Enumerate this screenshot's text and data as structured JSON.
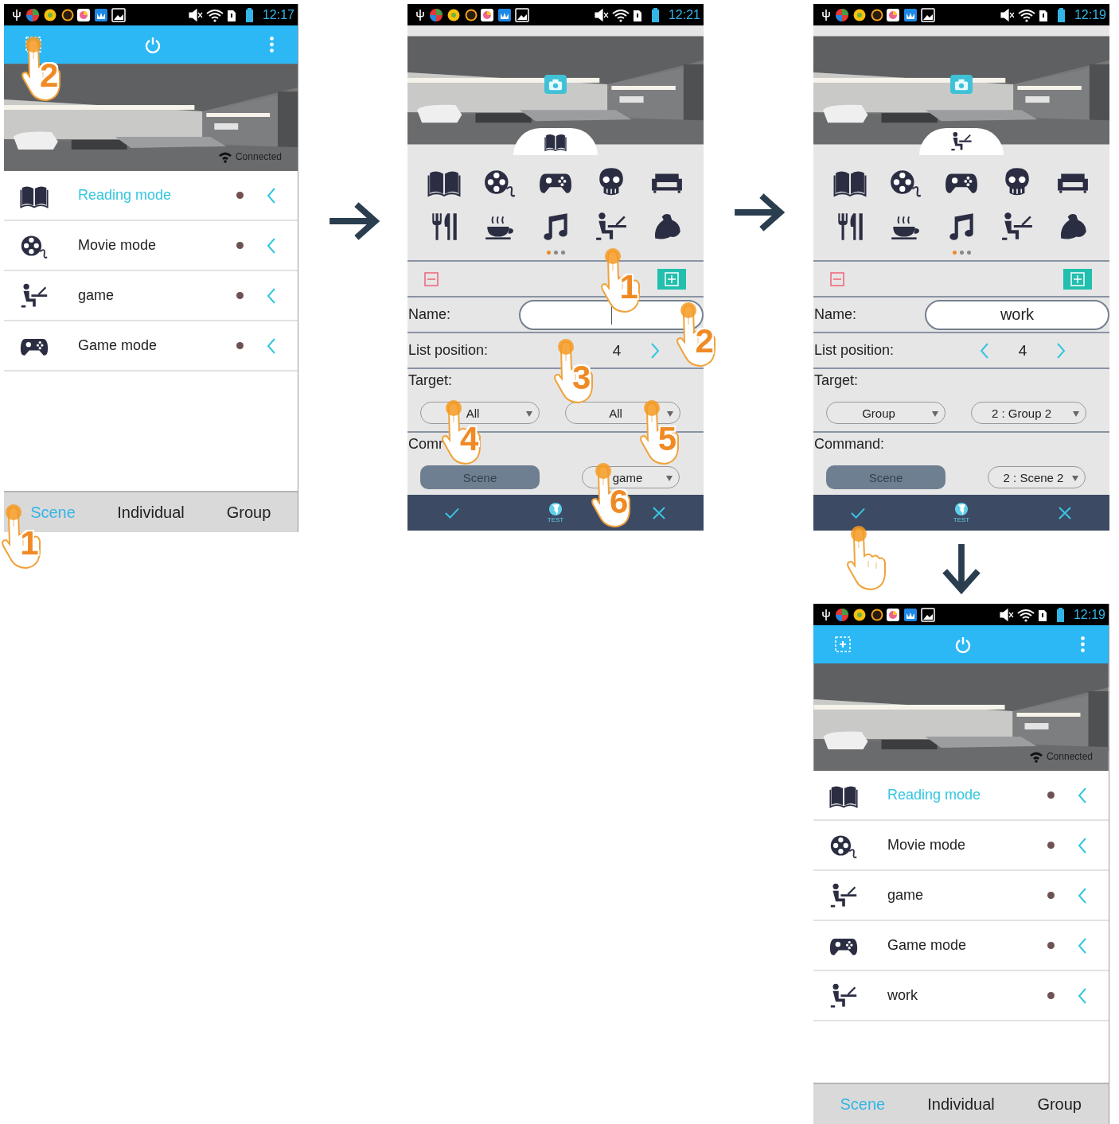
{
  "screens": [
    {
      "kind": "scene_list",
      "status_bar": {
        "time": "12:17"
      },
      "add_tap": "2",
      "connection": "Connected",
      "scenes": [
        {
          "name": "Reading mode",
          "kind": "book",
          "selected": true
        },
        {
          "name": "Movie mode",
          "kind": "film",
          "selected": false
        },
        {
          "name": "game",
          "kind": "desk",
          "selected": false
        },
        {
          "name": "Game mode",
          "kind": "gamepad",
          "selected": false
        }
      ],
      "tabs": [
        {
          "label": "Scene",
          "selected": true,
          "tap": "1"
        },
        {
          "label": "Individual",
          "selected": false
        },
        {
          "label": "Group",
          "selected": false
        }
      ]
    },
    {
      "kind": "scene_editor",
      "status_bar": {
        "time": "12:21"
      },
      "current_icon": {
        "kind": "book"
      },
      "icons": [
        {
          "kind": "book"
        },
        {
          "kind": "film"
        },
        {
          "kind": "gamepad"
        },
        {
          "kind": "skull"
        },
        {
          "kind": "sofa"
        },
        {
          "kind": "dining"
        },
        {
          "kind": "coffee"
        },
        {
          "kind": "music"
        },
        {
          "kind": "desk",
          "tap": "1"
        },
        {
          "kind": "muscle"
        }
      ],
      "page_dots": [
        {
          "selected": true
        },
        {
          "selected": false
        },
        {
          "selected": false
        }
      ],
      "name_field": {
        "label": "Name:",
        "focused": true,
        "tap": "2"
      },
      "list_position": {
        "label": "List position:",
        "value": "4",
        "prev_arrow": false,
        "next_arrow": true,
        "tap": "3"
      },
      "target": {
        "label": "Target:",
        "selects": [
          {
            "value": "All",
            "tap": "4"
          },
          {
            "value": "All",
            "tap": "5"
          }
        ]
      },
      "command": {
        "label": "Comr",
        "button": "Scene",
        "select": {
          "value": "game",
          "tap": "6"
        }
      },
      "bottom_bar": {
        "test_label": "TEST"
      }
    },
    {
      "kind": "scene_editor",
      "status_bar": {
        "time": "12:19"
      },
      "current_icon": {
        "kind": "desk"
      },
      "icons": [
        {
          "kind": "book"
        },
        {
          "kind": "film"
        },
        {
          "kind": "gamepad"
        },
        {
          "kind": "skull"
        },
        {
          "kind": "sofa"
        },
        {
          "kind": "dining"
        },
        {
          "kind": "coffee"
        },
        {
          "kind": "music"
        },
        {
          "kind": "desk"
        },
        {
          "kind": "muscle"
        }
      ],
      "page_dots": [
        {
          "selected": true
        },
        {
          "selected": false
        },
        {
          "selected": false
        }
      ],
      "name_field": {
        "label": "Name:",
        "value": "work",
        "focused": false
      },
      "list_position": {
        "label": "List position:",
        "value": "4",
        "prev_arrow": true,
        "next_arrow": true
      },
      "target": {
        "label": "Target:",
        "selects": [
          {
            "value": "Group"
          },
          {
            "value": "2 : Group 2"
          }
        ]
      },
      "command": {
        "label": "Command:",
        "button": "Scene",
        "select": {
          "value": "2 : Scene 2"
        }
      },
      "bottom_bar": {
        "test_label": "TEST",
        "confirm_tapped": true
      }
    },
    {
      "kind": "scene_list",
      "status_bar": {
        "time": "12:19"
      },
      "connection": "Connected",
      "scenes": [
        {
          "name": "Reading mode",
          "kind": "book",
          "selected": true
        },
        {
          "name": "Movie mode",
          "kind": "film",
          "selected": false
        },
        {
          "name": "game",
          "kind": "desk",
          "selected": false
        },
        {
          "name": "Game mode",
          "kind": "gamepad",
          "selected": false
        },
        {
          "name": "work",
          "kind": "desk",
          "selected": false
        }
      ],
      "tabs": [
        {
          "label": "Scene",
          "selected": true
        },
        {
          "label": "Individual",
          "selected": false
        },
        {
          "label": "Group",
          "selected": false
        }
      ]
    }
  ]
}
